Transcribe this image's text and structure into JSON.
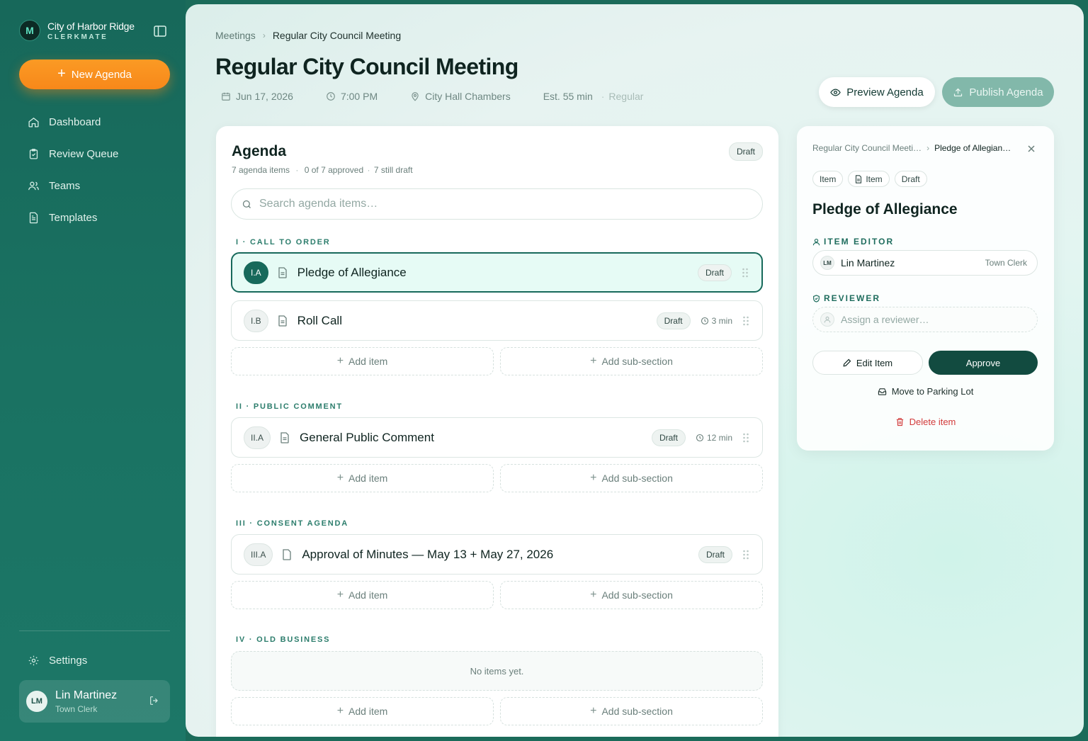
{
  "brand": {
    "name": "City of Harbor Ridge",
    "product": "CLERKMATE",
    "logo_letter": "M"
  },
  "sidebar": {
    "new_agenda_label": "New Agenda",
    "items": [
      {
        "label": "Dashboard",
        "icon": "home-icon"
      },
      {
        "label": "Review Queue",
        "icon": "clipboard-check-icon"
      },
      {
        "label": "Teams",
        "icon": "users-icon"
      },
      {
        "label": "Templates",
        "icon": "file-text-icon"
      }
    ],
    "settings_label": "Settings",
    "user": {
      "initials": "LM",
      "name": "Lin Martinez",
      "role": "Town Clerk"
    }
  },
  "header": {
    "breadcrumb": {
      "parent": "Meetings",
      "current": "Regular City Council Meeting"
    },
    "title": "Regular City Council Meeting",
    "meta": {
      "date": "Jun 17, 2026",
      "time": "7:00 PM",
      "location": "City Hall Chambers",
      "estimate": "Est. 55 min",
      "type": "Regular"
    },
    "preview_label": "Preview Agenda",
    "publish_label": "Publish Agenda"
  },
  "agenda": {
    "title": "Agenda",
    "status": "Draft",
    "summary": {
      "count": "7 agenda items",
      "approved": "0 of 7 approved",
      "draft": "7 still draft"
    },
    "search_placeholder": "Search agenda items…",
    "add_item_label": "Add item",
    "add_subsection_label": "Add sub-section",
    "empty_label": "No items yet.",
    "sections": [
      {
        "label": "I · CALL TO ORDER",
        "items": [
          {
            "code": "I.A",
            "title": "Pledge of Allegiance",
            "status": "Draft",
            "duration": ""
          },
          {
            "code": "I.B",
            "title": "Roll Call",
            "status": "Draft",
            "duration": "3 min"
          }
        ]
      },
      {
        "label": "II · PUBLIC COMMENT",
        "items": [
          {
            "code": "II.A",
            "title": "General Public Comment",
            "status": "Draft",
            "duration": "12 min"
          }
        ]
      },
      {
        "label": "III · CONSENT AGENDA",
        "items": [
          {
            "code": "III.A",
            "title": "Approval of Minutes — May 13 + May 27, 2026",
            "status": "Draft",
            "duration": ""
          }
        ]
      },
      {
        "label": "IV · OLD BUSINESS",
        "items": []
      }
    ]
  },
  "detail": {
    "breadcrumb": {
      "parent": "Regular City Council Meeti…",
      "current": "Pledge of Allegian…"
    },
    "tags": {
      "kind": "Item",
      "doc": "Item",
      "status": "Draft"
    },
    "title": "Pledge of Allegiance",
    "editor_label": "ITEM EDITOR",
    "editor": {
      "initials": "LM",
      "name": "Lin Martinez",
      "role": "Town Clerk"
    },
    "reviewer_label": "REVIEWER",
    "reviewer_placeholder": "Assign a reviewer…",
    "edit_label": "Edit Item",
    "approve_label": "Approve",
    "parking_label": "Move to Parking Lot",
    "delete_label": "Delete item"
  },
  "colors": {
    "sidebar": "#17685a",
    "accent": "#f7881a",
    "primary": "#124b40",
    "danger": "#d23a3a"
  }
}
